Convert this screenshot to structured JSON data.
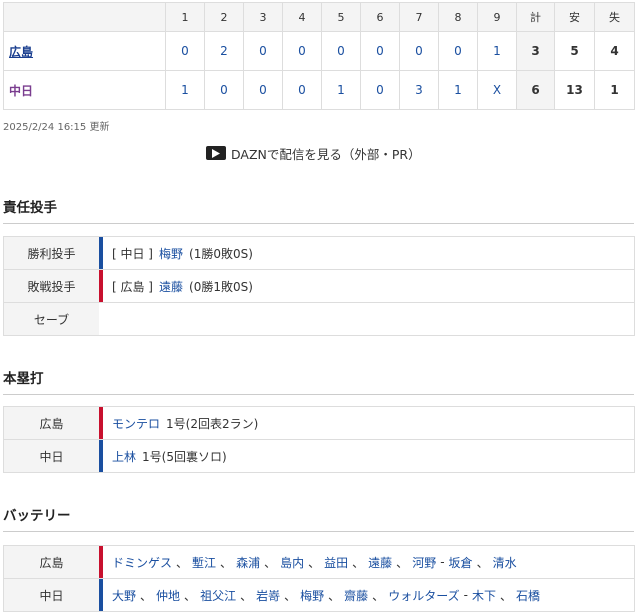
{
  "scoreboard": {
    "headers": [
      "1",
      "2",
      "3",
      "4",
      "5",
      "6",
      "7",
      "8",
      "9",
      "計",
      "安",
      "失"
    ],
    "teams": [
      {
        "name": "広島",
        "innings": [
          "0",
          "2",
          "0",
          "0",
          "0",
          "0",
          "0",
          "0",
          "1"
        ],
        "total": "3",
        "hits": "5",
        "errors": "4"
      },
      {
        "name": "中日",
        "innings": [
          "1",
          "0",
          "0",
          "0",
          "1",
          "0",
          "3",
          "1",
          "X"
        ],
        "total": "6",
        "hits": "13",
        "errors": "1"
      }
    ]
  },
  "updated": "2025/2/24 16:15 更新",
  "dazn_label": "DAZNで配信を見る（外部・PR）",
  "pitchers": {
    "title": "責任投手",
    "rows": [
      {
        "label": "勝利投手",
        "team": "[ 中日 ]",
        "name": "梅野",
        "record": "(1勝0敗0S)"
      },
      {
        "label": "敗戦投手",
        "team": "[ 広島 ]",
        "name": "遠藤",
        "record": "(0勝1敗0S)"
      },
      {
        "label": "セーブ",
        "team": "",
        "name": "",
        "record": ""
      }
    ]
  },
  "homeruns": {
    "title": "本塁打",
    "rows": [
      {
        "team": "広島",
        "name": "モンテロ",
        "detail": "1号(2回表2ラン)"
      },
      {
        "team": "中日",
        "name": "上林",
        "detail": "1号(5回裏ソロ)"
      }
    ]
  },
  "battery": {
    "title": "バッテリー",
    "rows": [
      {
        "team": "広島",
        "players": [
          "ドミンゲス",
          "、",
          "塹江",
          "、",
          "森浦",
          "、",
          "島内",
          "、",
          "益田",
          "、",
          "遠藤",
          "、",
          "河野",
          "-",
          "坂倉",
          "、",
          "清水"
        ]
      },
      {
        "team": "中日",
        "players": [
          "大野",
          "、",
          "仲地",
          "、",
          "祖父江",
          "、",
          "岩嵜",
          "、",
          "梅野",
          "、",
          "齋藤",
          "、",
          "ウォルターズ",
          "-",
          "木下",
          "、",
          "石橋"
        ]
      }
    ]
  }
}
